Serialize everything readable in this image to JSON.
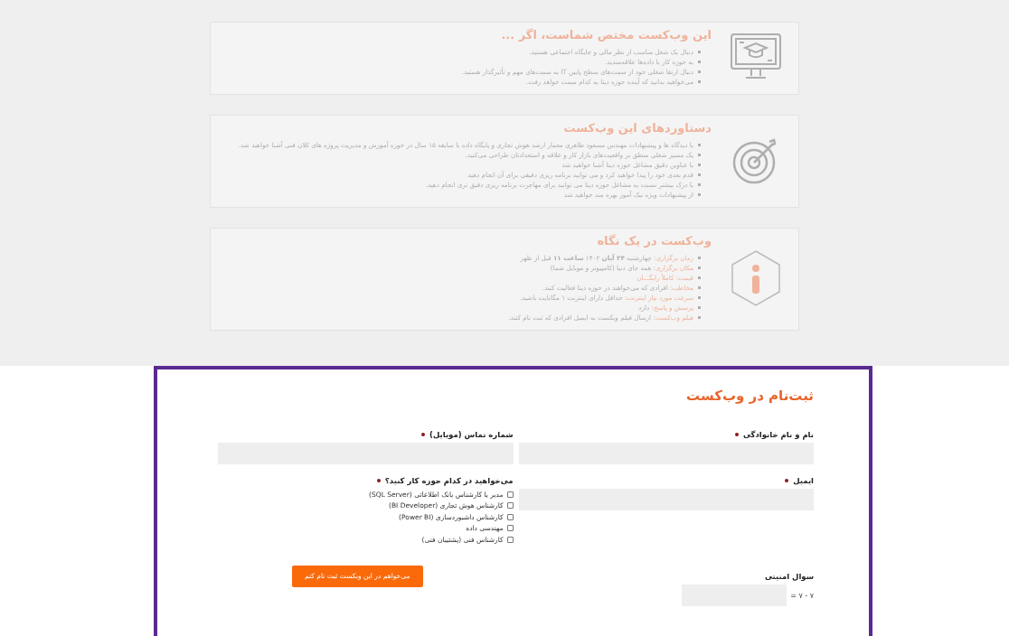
{
  "cards": [
    {
      "title": "این وب‌کست مختص شماست، اگر ...",
      "items": [
        {
          "text": "دنبال یک شغل مناسب از نظر مالی و جایگاه اجتماعی هستید."
        },
        {
          "text": "به حوزه کار با داده‌ها علاقه‌مندید."
        },
        {
          "text": "دنبال ارتقا شغلی خود از سمت‌های سطح پایین IT به سمت‌های مهم و تأثیرگذار هستید."
        },
        {
          "text": "می‌خواهید بدانید که آینده حوزه دیتا به کدام سمت خواهد رفت."
        }
      ]
    },
    {
      "title": "دستاوردهای این وب‌کست",
      "items": [
        {
          "text": "با دیدگاه ها و پیشنهادات مهندس مسعود طاهری معمار ارشد هوش تجاری و پایگاه داده با سابقه ۱۵ سال در حوزه آموزش و مدیریت پروژه های کلان فنی آشنا خواهید شد."
        },
        {
          "text": "یک مسیر شغلی منطق بر واقعیت‌های بازار کار و علاقه و استعدادتان طراحی می‌کنید."
        },
        {
          "text": "با عناوین دقیق مشاغل حوزه دیتا آشنا خواهید شد"
        },
        {
          "text": "قدم بعدی خود را پیدا خواهید کرد و می توانید برنامه ریزی دقیقی برای آن انجام دهید"
        },
        {
          "text": "با درک بیشتر نسبت به مشاغل حوزه دیتا می توانید برای مهاجرت برنامه ریزی دقیق تری انجام دهید."
        },
        {
          "text": "از پیشنهادات ویژه نیک آموز بهره مند خواهید شد"
        }
      ]
    },
    {
      "title": "وب‌کست در یک نگاه",
      "items": [
        {
          "label": "زمان برگزاری:",
          "text": "چهارشنبه **۲۴ آبان** ۱۴۰۲ **ساعت ۱۱** قبل از ظهر"
        },
        {
          "label": "مکان برگزاری:",
          "text": "همه جای دنیا (کامپیوتر و موبایل شما)"
        },
        {
          "label": "قیمت: کاملاً رایگـــان"
        },
        {
          "label": "مخاطب:",
          "text": "افرادی که می‌خواهند در حوزه دیتا فعالیت کنند."
        },
        {
          "label": "سرعت مورد نیاز اینترنت:",
          "text": "حداقل دارای اینترنت ۱ مگابایت باشید."
        },
        {
          "label": "پرسش و پاسخ:",
          "text": "دارد"
        },
        {
          "label": "فیلم وب‌کست:",
          "text": "ارسال فیلم وبکست به ایمیل افرادی که ثبت نام کنند."
        }
      ]
    }
  ],
  "form": {
    "title": "ثبت‌نام در وب‌کست",
    "name_field": {
      "label": "نام و نام خانوادگی",
      "required": true
    },
    "phone_field": {
      "label": "شماره تماس (موبایل)",
      "required": true
    },
    "email_field": {
      "label": "ایمیل",
      "required": true
    },
    "area_question": {
      "label": "می‌خواهید در کدام حوزه کار کنید؟",
      "required": true,
      "options": [
        {
          "label": "مدیر یا کارشناس بانک اطلاعاتی (SQL Server)",
          "checked": false
        },
        {
          "label": "کارشناس هوش تجاری (BI Developer)",
          "checked": false
        },
        {
          "label": "کارشناس داشبوردسازی (Power BI)",
          "checked": false
        },
        {
          "label": "مهندسی داده",
          "checked": false
        },
        {
          "label": "کارشناس فنی (پشتیبان فنی)",
          "checked": false
        }
      ]
    },
    "security": {
      "label": "سوال امنیتی",
      "question": "= ۷ - ۷"
    },
    "submit": "می‌خواهم در این وبکست ثبت نام کنم"
  }
}
